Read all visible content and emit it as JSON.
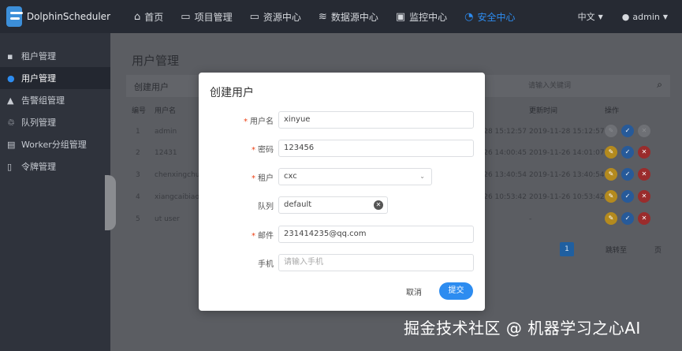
{
  "app": {
    "name": "DolphinScheduler"
  },
  "nav": {
    "items": [
      {
        "label": "首页",
        "icon": "home-icon"
      },
      {
        "label": "项目管理",
        "icon": "folder-icon"
      },
      {
        "label": "资源中心",
        "icon": "folder-icon"
      },
      {
        "label": "数据源中心",
        "icon": "database-icon"
      },
      {
        "label": "监控中心",
        "icon": "monitor-icon"
      },
      {
        "label": "安全中心",
        "icon": "shield-icon",
        "active": true
      }
    ],
    "language": "中文",
    "user": "admin"
  },
  "sidebar": {
    "items": [
      {
        "label": "租户管理",
        "icon": "users-icon"
      },
      {
        "label": "用户管理",
        "icon": "user-icon",
        "active": true
      },
      {
        "label": "告警组管理",
        "icon": "warning-icon"
      },
      {
        "label": "队列管理",
        "icon": "recycle-icon"
      },
      {
        "label": "Worker分组管理",
        "icon": "server-icon"
      },
      {
        "label": "令牌管理",
        "icon": "document-icon"
      }
    ]
  },
  "page": {
    "title": "用户管理",
    "create_label": "创建用户",
    "search_placeholder": "请输入关键词"
  },
  "table": {
    "headers": {
      "id": "编号",
      "name": "用户名",
      "updated": "更新时间",
      "ops": "操作"
    },
    "rows": [
      {
        "id": "1",
        "name": "admin",
        "created": "-28 15:12:57",
        "updated": "2019-11-28 15:12:57"
      },
      {
        "id": "2",
        "name": "12431",
        "created": "-26 14:00:45",
        "updated": "2019-11-26 14:01:07"
      },
      {
        "id": "3",
        "name": "chenxingchun",
        "created": "-26 13:40:54",
        "updated": "2019-11-26 13:40:54"
      },
      {
        "id": "4",
        "name": "xiangcaibiao",
        "created": "-26 10:53:42",
        "updated": "2019-11-26 10:53:42"
      },
      {
        "id": "5",
        "name": "ut user",
        "created": "",
        "updated": "-"
      }
    ]
  },
  "pager": {
    "current": "1",
    "jump_label": "跳转至",
    "page_label": "页"
  },
  "modal": {
    "title": "创建用户",
    "fields": {
      "username": {
        "label": "用户名",
        "value": "xinyue"
      },
      "password": {
        "label": "密码",
        "value": "123456"
      },
      "tenant": {
        "label": "租户",
        "value": "cxc"
      },
      "queue": {
        "label": "队列",
        "value": "default"
      },
      "email": {
        "label": "邮件",
        "value": "231414235@qq.com"
      },
      "phone": {
        "label": "手机",
        "placeholder": "请输入手机"
      }
    },
    "required_mark": "*",
    "cancel_label": "取消",
    "submit_label": "提交"
  },
  "watermark": "掘金技术社区 @ 机器学习之心AI",
  "colors": {
    "primary": "#2d8cf0",
    "nav_bg": "#262a33",
    "sidebar_bg": "#2f333c",
    "required": "#ed4014"
  }
}
